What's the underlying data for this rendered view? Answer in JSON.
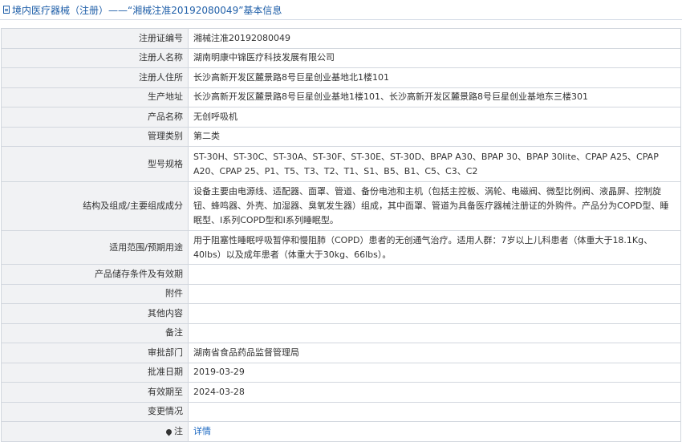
{
  "header": {
    "title": "境内医疗器械（注册）——“湘械注准20192080049”基本信息"
  },
  "rows": [
    {
      "label": "注册证编号",
      "value": "湘械注准20192080049"
    },
    {
      "label": "注册人名称",
      "value": "湖南明康中锦医疗科技发展有限公司"
    },
    {
      "label": "注册人住所",
      "value": "长沙高新开发区麓景路8号巨星创业基地北1楼101"
    },
    {
      "label": "生产地址",
      "value": "长沙高新开发区麓景路8号巨星创业基地1楼101、长沙高新开发区麓景路8号巨星创业基地东三楼301"
    },
    {
      "label": "产品名称",
      "value": "无创呼吸机"
    },
    {
      "label": "管理类别",
      "value": "第二类"
    },
    {
      "label": "型号规格",
      "value": "ST-30H、ST-30C、ST-30A、ST-30F、ST-30E、ST-30D、BPAP A30、BPAP 30、BPAP 30lite、CPAP A25、CPAP A20、CPAP 25、P1、T5、T3、T2、T1、S1、B5、B1、C5、C3、C2"
    },
    {
      "label": "结构及组成/主要组成成分",
      "value": "设备主要由电源线、适配器、面罩、管道、备份电池和主机（包括主控板、涡轮、电磁阀、微型比例阀、液晶屏、控制旋钮、蜂鸣器、外壳、加湿器、臭氧发生器）组成，其中面罩、管道为具备医疗器械注册证的外购件。产品分为COPD型、睡眠型、Ⅰ系列COPD型和Ⅰ系列睡眠型。"
    },
    {
      "label": "适用范围/预期用途",
      "value": "用于阻塞性睡眠呼吸暂停和慢阻肺（COPD）患者的无创通气治疗。适用人群：7岁以上儿科患者（体重大于18.1Kg、40lbs）以及成年患者（体重大于30kg、66lbs）。"
    },
    {
      "label": "产品储存条件及有效期",
      "value": ""
    },
    {
      "label": "附件",
      "value": ""
    },
    {
      "label": "其他内容",
      "value": ""
    },
    {
      "label": "备注",
      "value": ""
    },
    {
      "label": "审批部门",
      "value": "湖南省食品药品监督管理局"
    },
    {
      "label": "批准日期",
      "value": "2019-03-29"
    },
    {
      "label": "有效期至",
      "value": "2024-03-28"
    },
    {
      "label": "变更情况",
      "value": ""
    }
  ],
  "note": {
    "label": "注",
    "link": "详情",
    "icon": "pin-icon"
  }
}
